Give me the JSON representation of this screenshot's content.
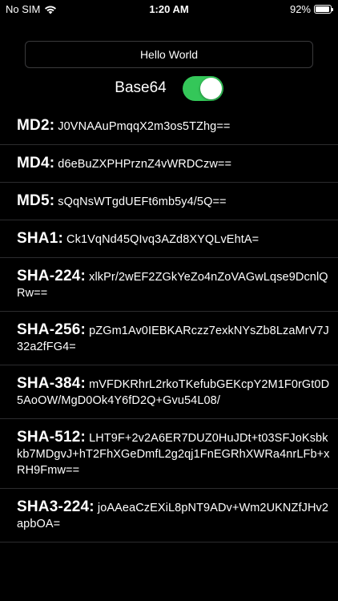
{
  "status_bar": {
    "carrier": "No SIM",
    "time": "1:20 AM",
    "battery": "92%",
    "battery_level": 0.92
  },
  "input": {
    "value": "Hello World"
  },
  "toggle": {
    "label": "Base64",
    "on": true,
    "color": "#34c759"
  },
  "hashes": [
    {
      "name": "MD2:",
      "value": "J0VNAAuPmqqX2m3os5TZhg=="
    },
    {
      "name": "MD4:",
      "value": "d6eBuZXPHPrznZ4vWRDCzw=="
    },
    {
      "name": "MD5:",
      "value": "sQqNsWTgdUEFt6mb5y4/5Q=="
    },
    {
      "name": "SHA1:",
      "value": "Ck1VqNd45QIvq3AZd8XYQLvEhtA="
    },
    {
      "name": "SHA-224:",
      "value": "xlkPr/2wEF2ZGkYeZo4nZoVAGwLqse9DcnlQRw=="
    },
    {
      "name": "SHA-256:",
      "value": "pZGm1Av0IEBKARczz7exkNYsZb8LzaMrV7J32a2fFG4="
    },
    {
      "name": "SHA-384:",
      "value": "mVFDKRhrL2rkoTKefubGEKcpY2M1F0rGt0D5AoOW/MgD0Ok4Y6fD2Q+Gvu54L08/"
    },
    {
      "name": "SHA-512:",
      "value": "LHT9F+2v2A6ER7DUZ0HuJDt+t03SFJoKsbkkb7MDgvJ+hT2FhXGeDmfL2g2qj1FnEGRhXWRa4nrLFb+xRH9Fmw=="
    },
    {
      "name": "SHA3-224:",
      "value": "joAAeaCzEXiL8pNT9ADv+Wm2UKNZfJHv2apbOA="
    }
  ]
}
